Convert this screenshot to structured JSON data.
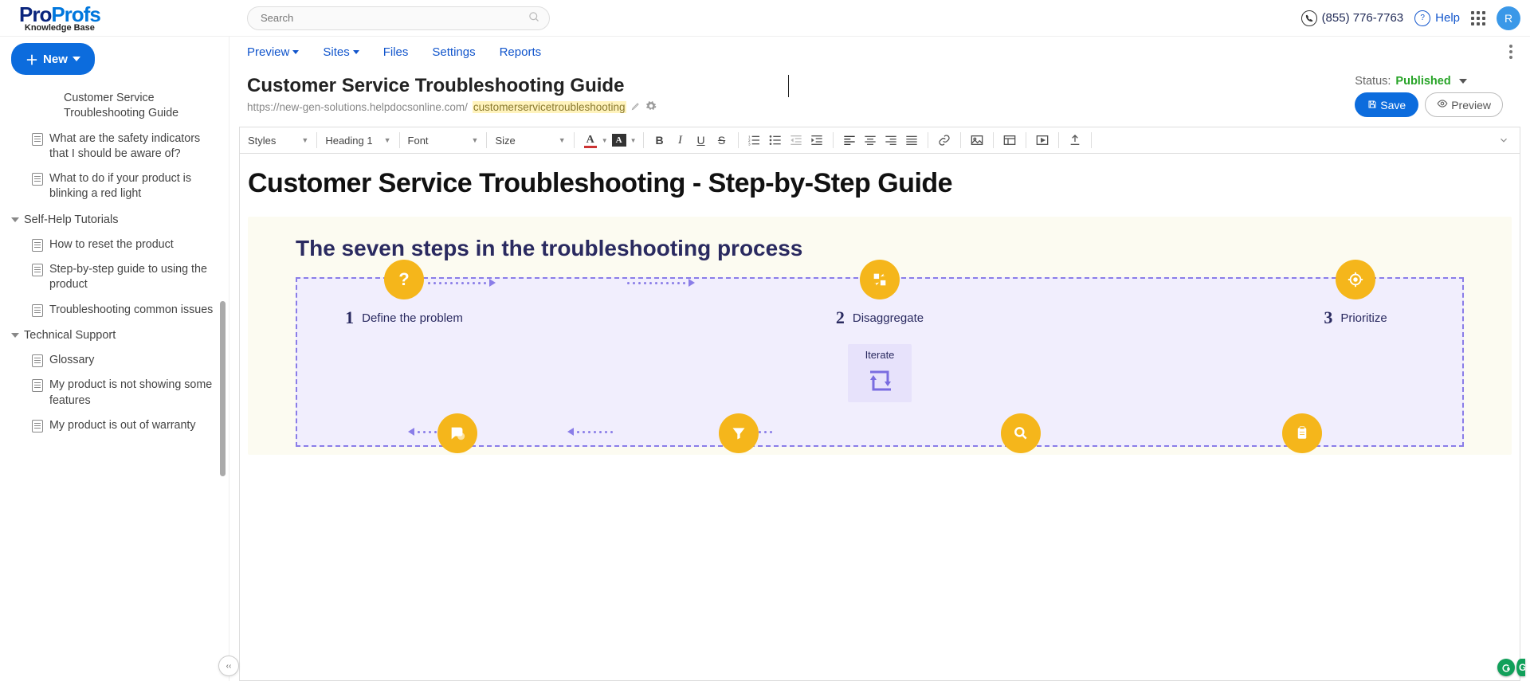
{
  "header": {
    "logo_line1_a": "Pro",
    "logo_line1_b": "Profs",
    "logo_line2": "Knowledge Base",
    "search_placeholder": "Search",
    "phone": "(855) 776-7763",
    "help": "Help",
    "avatar_initial": "R"
  },
  "new_button": "New",
  "sidebar": {
    "items": [
      {
        "label": "Customer Service Troubleshooting Guide",
        "indent": "child",
        "nodoc": true
      },
      {
        "label": "What are the safety indicators that I should be aware of?",
        "indent": "item"
      },
      {
        "label": "What to do if your product is blinking a red light",
        "indent": "item"
      }
    ],
    "group2": "Self-Help Tutorials",
    "group2_items": [
      {
        "label": "How to reset the product"
      },
      {
        "label": "Step-by-step guide to using the product"
      },
      {
        "label": "Troubleshooting common issues"
      }
    ],
    "group3": "Technical Support",
    "group3_items": [
      {
        "label": "Glossary"
      },
      {
        "label": "My product is not showing some features"
      },
      {
        "label": "My product is out of warranty"
      }
    ]
  },
  "menu": {
    "preview": "Preview",
    "sites": "Sites",
    "files": "Files",
    "settings": "Settings",
    "reports": "Reports"
  },
  "page": {
    "title": "Customer Service Troubleshooting Guide",
    "url_prefix": "https://new-gen-solutions.helpdocsonline.com/",
    "url_slug": "customerservicetroubleshooting",
    "status_label": "Status:",
    "status_value": "Published",
    "save": "Save",
    "preview": "Preview"
  },
  "toolbar": {
    "styles": "Styles",
    "format": "Heading 1",
    "font": "Font",
    "size": "Size"
  },
  "editor": {
    "h1": "Customer Service Troubleshooting - Step-by-Step Guide",
    "info_title": "The seven steps in the troubleshooting process",
    "steps_top": [
      {
        "num": "1",
        "txt": "Define the problem"
      },
      {
        "num": "2",
        "txt": "Disaggregate"
      },
      {
        "num": "3",
        "txt": "Prioritize"
      }
    ],
    "iterate": "Iterate"
  }
}
